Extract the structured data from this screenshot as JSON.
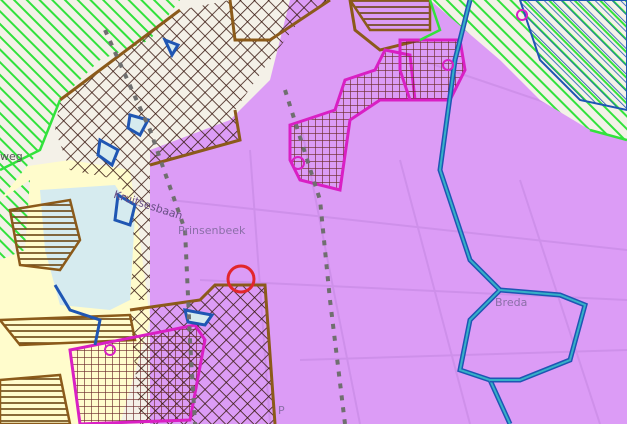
{
  "map": {
    "labels": {
      "village": "Prinsenbeek",
      "city": "Breda",
      "street": "Kruitsesbaan",
      "edge_left": "weg",
      "edge_bottom": "P"
    },
    "colors": {
      "base_light": "#f4f1e8",
      "pale_yellow": "#fffccc",
      "pale_blue": "#d6ebef",
      "green_hatch": "#32e23c",
      "purple_zone": "#dc9cf6",
      "magenta_outline": "#d91fc4",
      "brown_outline": "#8b5a1a",
      "cross_hatch": "#3a1a12",
      "water_line": "#1f56b3",
      "water_highlight": "#35b1c8",
      "marker_red": "#e2262c",
      "rail_gray": "#6f6f6f"
    },
    "markers": {
      "location_marker": "selection-circle-icon"
    }
  }
}
